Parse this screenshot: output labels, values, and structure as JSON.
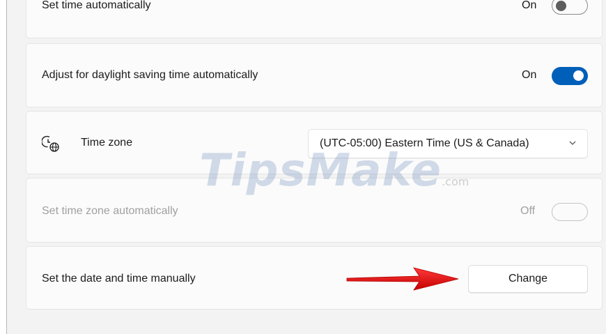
{
  "settings": {
    "set_time_auto": {
      "label": "Set time automatically",
      "state": "On"
    },
    "daylight": {
      "label": "Adjust for daylight saving time automatically",
      "state": "On"
    },
    "timezone": {
      "label": "Time zone",
      "value": "(UTC-05:00) Eastern Time (US & Canada)",
      "icon": "clock-globe-icon"
    },
    "tz_auto": {
      "label": "Set time zone automatically",
      "state": "Off"
    },
    "manual": {
      "label": "Set the date and time manually",
      "button": "Change"
    }
  },
  "watermark": {
    "main": "TipsMake",
    "suffix": ".com"
  },
  "colors": {
    "accent": "#005fb8",
    "arrow": "#e1141b",
    "background": "#f3f3f3",
    "card": "#fbfbfb"
  }
}
